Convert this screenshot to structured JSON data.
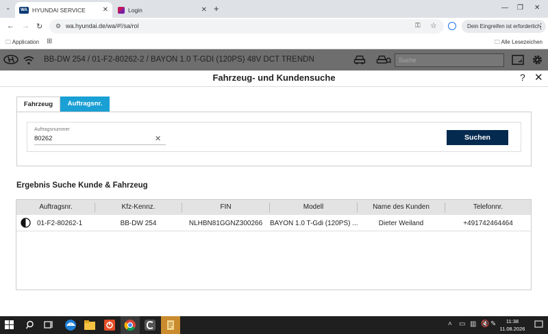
{
  "browser": {
    "tabs": [
      {
        "label": "HYUNDAI SERVICE",
        "favicon_text": "WA",
        "favicon_color": "#0b3a75",
        "active": true
      },
      {
        "label": "Login",
        "favicon_color": "#c2185b",
        "active": false
      }
    ],
    "url": "wa.hyundai.de/wa/#!/sa/rol",
    "signin_label": "Dein Eingreifen ist erforderlich",
    "bookmarks": {
      "application": "Application",
      "all": "Alle Lesezeichen"
    }
  },
  "appbar": {
    "vehicle_info": "BB-DW 254 / 01-F2-80262-2 / BAYON 1.0 T-GDI (120PS) 48V DCT TRENDN",
    "search_placeholder": "Suche",
    "bg_color": "#6e6e6e"
  },
  "header": {
    "title": "Fahrzeug- und Kundensuche",
    "help": "?",
    "close": "✕"
  },
  "tabs": [
    {
      "label": "Fahrzeug",
      "active": false
    },
    {
      "label": "Auftragsnr.",
      "active": true
    }
  ],
  "accent_color": "#1aa0d4",
  "form": {
    "field_label": "Auftragsnummer",
    "field_value": "80262",
    "clear": "✕",
    "search_button": "Suchen",
    "button_color": "#052a4f"
  },
  "results": {
    "title": "Ergebnis Suche Kunde & Fahrzeug",
    "columns": [
      "Auftragsnr.",
      "Kfz-Kennz.",
      "FIN",
      "Modell",
      "Name des Kunden",
      "Telefonnr."
    ],
    "rows": [
      [
        "01-F2-80262-1",
        "BB-DW 254",
        "NLHBN81GGNZ300266",
        "BAYON 1.0 T-Gdi (120PS) ...",
        "Dieter Weiland",
        "+491742464464"
      ]
    ]
  },
  "taskbar": {
    "time": "11:38",
    "date": "11.08.2026"
  }
}
